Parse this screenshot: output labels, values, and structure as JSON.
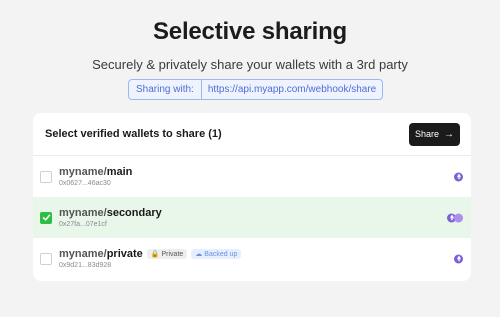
{
  "header": {
    "title": "Selective sharing",
    "subtitle": "Securely & privately share your wallets with a 3rd party"
  },
  "sharing": {
    "label": "Sharing with:",
    "url": "https://api.myapp.com/webhook/share"
  },
  "card": {
    "heading": "Select verified wallets to share (1)",
    "share_label": "Share",
    "share_icon": "arrow-right-icon"
  },
  "wallets": [
    {
      "prefix": "myname/",
      "name": "main",
      "address": "0x0627...46ac30",
      "selected": false,
      "chains": [
        "ethereum"
      ]
    },
    {
      "prefix": "myname/",
      "name": "secondary",
      "address": "0x27fa...07e1cf",
      "selected": true,
      "chains": [
        "ethereum",
        "multi-chain"
      ]
    },
    {
      "prefix": "myname/",
      "name": "private",
      "address": "0x9d21...83d928",
      "selected": false,
      "chains": [
        "ethereum"
      ],
      "tags": {
        "private": "Private",
        "backed": "Backed up"
      }
    }
  ],
  "colors": {
    "background": "#f3f3f3",
    "accent_blue": "#4f6fd6",
    "selected_row": "#e9f7ea",
    "check_green": "#2dbf45",
    "chain_purple": "#7b61d8"
  }
}
